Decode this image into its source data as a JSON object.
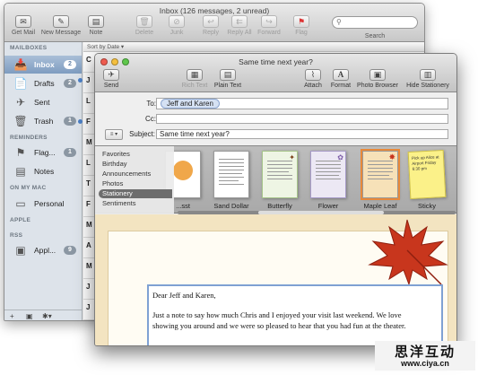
{
  "main_window": {
    "title": "Inbox (126 messages, 2 unread)",
    "toolbar": [
      {
        "label": "Get Mail",
        "icon": "envelope-icon",
        "glyph": "✉",
        "enabled": true
      },
      {
        "label": "New Message",
        "icon": "compose-icon",
        "glyph": "✎",
        "enabled": true
      },
      {
        "label": "Note",
        "icon": "note-icon",
        "glyph": "▤",
        "enabled": true
      },
      {
        "label": "Delete",
        "icon": "trash-icon",
        "glyph": "🗑",
        "enabled": false
      },
      {
        "label": "Junk",
        "icon": "junk-icon",
        "glyph": "⊘",
        "enabled": false
      },
      {
        "label": "Reply",
        "icon": "reply-icon",
        "glyph": "↩",
        "enabled": false
      },
      {
        "label": "Reply All",
        "icon": "reply-all-icon",
        "glyph": "⇇",
        "enabled": false
      },
      {
        "label": "Forward",
        "icon": "forward-icon",
        "glyph": "↪",
        "enabled": false
      },
      {
        "label": "Flag",
        "icon": "flag-icon",
        "glyph": "⚑",
        "enabled": false
      }
    ],
    "search_label": "Search",
    "sort_label": "Sort by Date ▾",
    "sidebar": {
      "sections": {
        "mailboxes": "MAILBOXES",
        "reminders": "REMINDERS",
        "on_my_mac": "ON MY MAC",
        "apple": "APPLE",
        "rss": "RSS"
      },
      "items": [
        {
          "label": "Inbox",
          "count": "2",
          "icon": "inbox-icon",
          "glyph": "📥"
        },
        {
          "label": "Drafts",
          "count": "2",
          "icon": "drafts-icon",
          "glyph": "📄"
        },
        {
          "label": "Sent",
          "count": "",
          "icon": "sent-icon",
          "glyph": "✈"
        },
        {
          "label": "Trash",
          "count": "1",
          "icon": "trash-icon",
          "glyph": "🗑"
        },
        {
          "label": "Flag...",
          "count": "1",
          "icon": "flag-icon",
          "glyph": "⚑"
        },
        {
          "label": "Notes",
          "count": "",
          "icon": "notes-icon",
          "glyph": "▤"
        },
        {
          "label": "Personal",
          "count": "",
          "icon": "folder-icon",
          "glyph": "▭"
        },
        {
          "label": "Appl...",
          "count": "9",
          "icon": "rss-icon",
          "glyph": "▣"
        }
      ],
      "footer": {
        "add": "+",
        "mailbox": "▣",
        "gear": "✱▾"
      }
    },
    "message_initials": [
      "C",
      "J",
      "L",
      "F",
      "M",
      "L",
      "T",
      "F",
      "M",
      "A",
      "M",
      "J",
      "J"
    ]
  },
  "compose_window": {
    "title": "Same time next year?",
    "toolbar": [
      {
        "label": "Send",
        "icon": "send-icon",
        "glyph": "✈",
        "enabled": true
      },
      {
        "label": "Rich Text",
        "icon": "rich-text-icon",
        "glyph": "▦",
        "enabled": false
      },
      {
        "label": "Plain Text",
        "icon": "plain-text-icon",
        "glyph": "▤",
        "enabled": true
      },
      {
        "label": "Attach",
        "icon": "paperclip-icon",
        "glyph": "⌇",
        "enabled": true
      },
      {
        "label": "Format",
        "icon": "format-icon",
        "glyph": "A",
        "enabled": true
      },
      {
        "label": "Photo Browser",
        "icon": "photo-icon",
        "glyph": "▣",
        "enabled": true
      },
      {
        "label": "Hide Stationery",
        "icon": "stationery-icon",
        "glyph": "▥",
        "enabled": true
      }
    ],
    "fields": {
      "to_label": "To:",
      "to_value": "Jeff and Karen",
      "cc_label": "Cc:",
      "cc_value": "",
      "subject_label": "Subject:",
      "subject_value": "Same time next year?",
      "account_selector": "≡ ▾"
    },
    "stationery": {
      "categories": [
        "Favorites",
        "Birthday",
        "Announcements",
        "Photos",
        "Stationery",
        "Sentiments"
      ],
      "selected_category": "Stationery",
      "templates": [
        "...sst",
        "Sand Dollar",
        "Butterfly",
        "Flower",
        "Maple Leaf",
        "Sticky"
      ],
      "selected_template": "Maple Leaf",
      "sticky_note_text": "Pick up Alice at Airport Friday 6:30 pm"
    },
    "body": {
      "greeting": "Dear Jeff and Karen,",
      "line1": "Just a note to say how much Chris and I enjoyed your visit last weekend. We love",
      "line2": "showing you around and we were so pleased to hear that you had fun at the theater."
    }
  },
  "watermark": {
    "text": "思洋互动",
    "url": "www.ciya.cn"
  },
  "colors": {
    "selection": "#7e9cc0",
    "token": "#d5e1f3",
    "stationery_bg": "#f3e4c1",
    "leaf": "#c8361d"
  }
}
